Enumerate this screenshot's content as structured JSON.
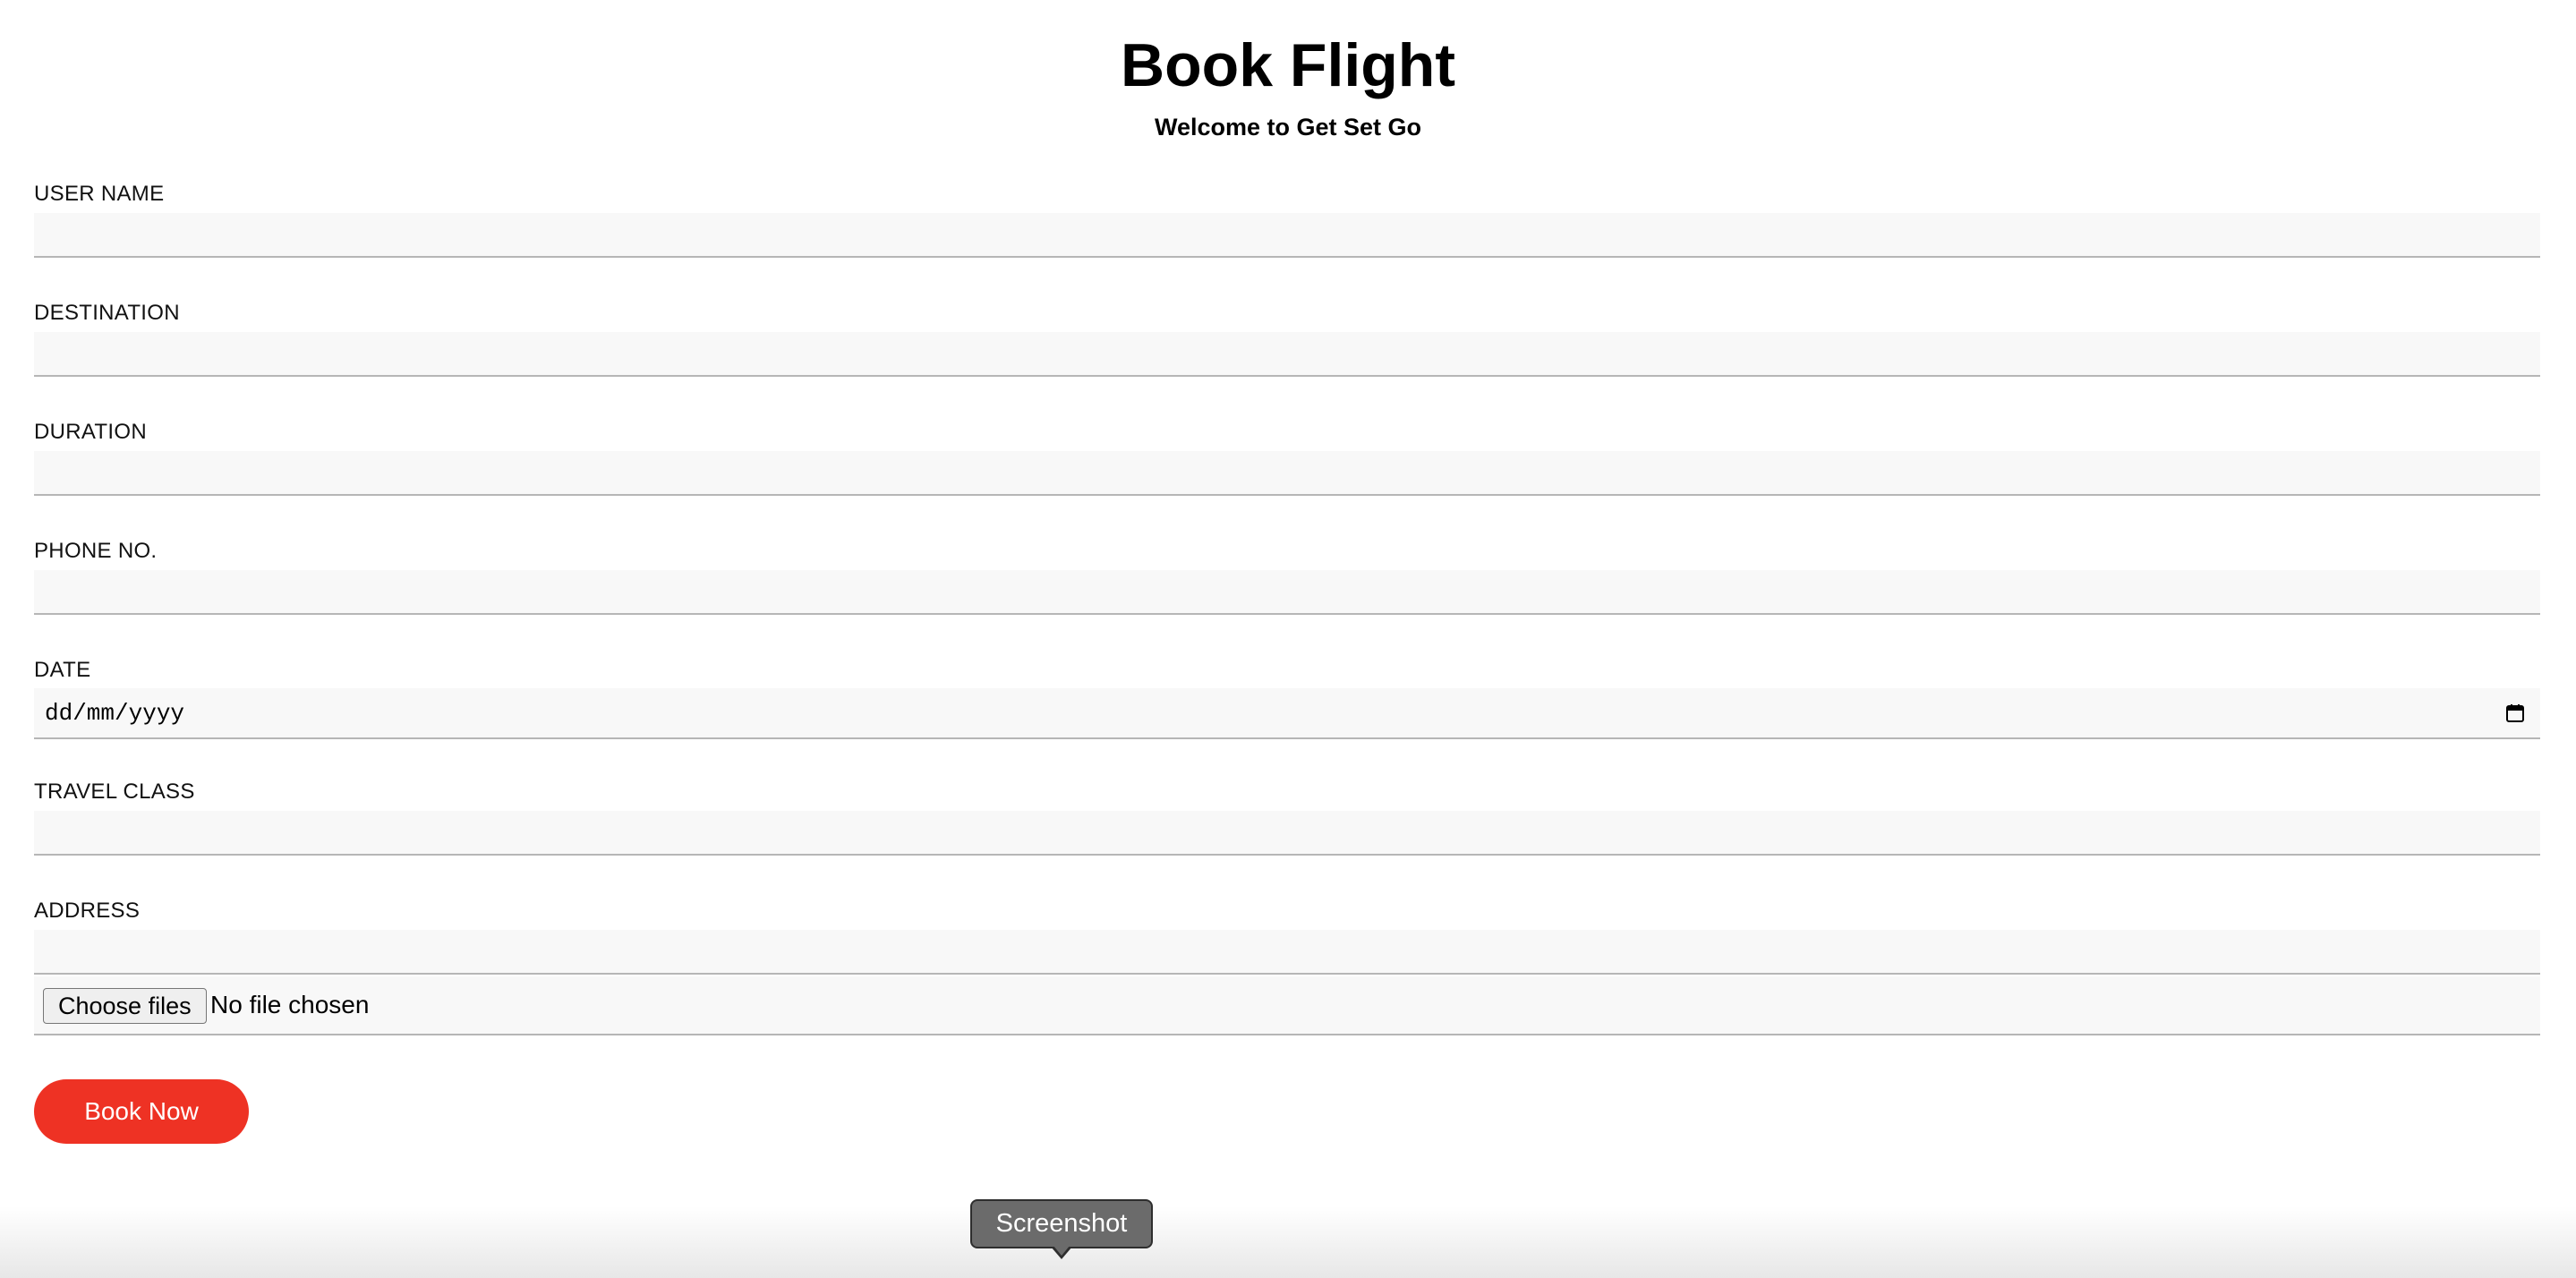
{
  "header": {
    "title": "Book Flight",
    "subtitle": "Welcome to Get Set Go"
  },
  "form": {
    "user_name": {
      "label": "USER NAME",
      "value": "",
      "placeholder": ""
    },
    "destination": {
      "label": "DESTINATION",
      "value": "",
      "placeholder": ""
    },
    "duration": {
      "label": "DURATION",
      "value": "",
      "placeholder": ""
    },
    "phone": {
      "label": "PHONE NO.",
      "value": "",
      "placeholder": ""
    },
    "date": {
      "label": "DATE",
      "placeholder": "dd/mm/yyyy",
      "icon": "calendar-icon"
    },
    "travel_class": {
      "label": "TRAVEL CLASS",
      "value": "",
      "placeholder": ""
    },
    "address": {
      "label": "ADDRESS",
      "value": "",
      "placeholder": ""
    },
    "file": {
      "button_label": "Choose files",
      "status": "No file chosen"
    },
    "submit_label": "Book Now"
  },
  "tooltip": {
    "text": "Screenshot"
  },
  "colors": {
    "accent": "#ee3224",
    "input_background": "#f8f8f8",
    "input_border": "#b6b6b6",
    "tooltip_background": "#6b6b6b"
  }
}
